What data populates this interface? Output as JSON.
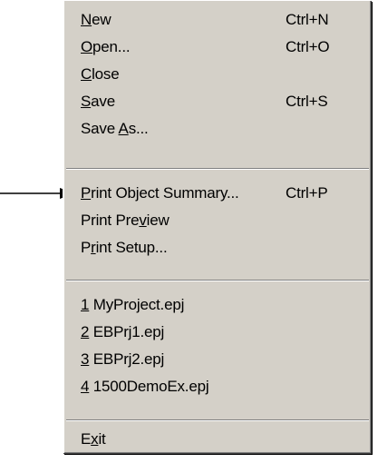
{
  "menu": {
    "groups": [
      {
        "items": [
          {
            "pre": "",
            "mn": "N",
            "post": "ew",
            "shortcut": "Ctrl+N"
          },
          {
            "pre": "",
            "mn": "O",
            "post": "pen...",
            "shortcut": "Ctrl+O"
          },
          {
            "pre": "",
            "mn": "C",
            "post": "lose",
            "shortcut": ""
          },
          {
            "pre": "",
            "mn": "S",
            "post": "ave",
            "shortcut": "Ctrl+S"
          },
          {
            "pre": "Save ",
            "mn": "A",
            "post": "s...",
            "shortcut": ""
          }
        ]
      },
      {
        "items": [
          {
            "pre": "",
            "mn": "P",
            "post": "rint Object Summary...",
            "shortcut": "Ctrl+P"
          },
          {
            "pre": "Print Pre",
            "mn": "v",
            "post": "iew",
            "shortcut": ""
          },
          {
            "pre": "P",
            "mn": "r",
            "post": "int Setup...",
            "shortcut": ""
          }
        ]
      },
      {
        "items": [
          {
            "pre": "",
            "mn": "1",
            "post": " MyProject.epj",
            "shortcut": ""
          },
          {
            "pre": "",
            "mn": "2",
            "post": " EBPrj1.epj",
            "shortcut": ""
          },
          {
            "pre": "",
            "mn": "3",
            "post": " EBPrj2.epj",
            "shortcut": ""
          },
          {
            "pre": "",
            "mn": "4",
            "post": " 1500DemoEx.epj",
            "shortcut": ""
          }
        ]
      },
      {
        "items": [
          {
            "pre": "E",
            "mn": "x",
            "post": "it",
            "shortcut": ""
          }
        ]
      }
    ]
  },
  "colors": {
    "menu_face": "#d4d0c8",
    "highlight": "#ffffff",
    "shadow": "#808080",
    "text": "#000000"
  },
  "callout": {
    "icon": "arrow-right-icon",
    "points_to": "Print Object Summary..."
  }
}
